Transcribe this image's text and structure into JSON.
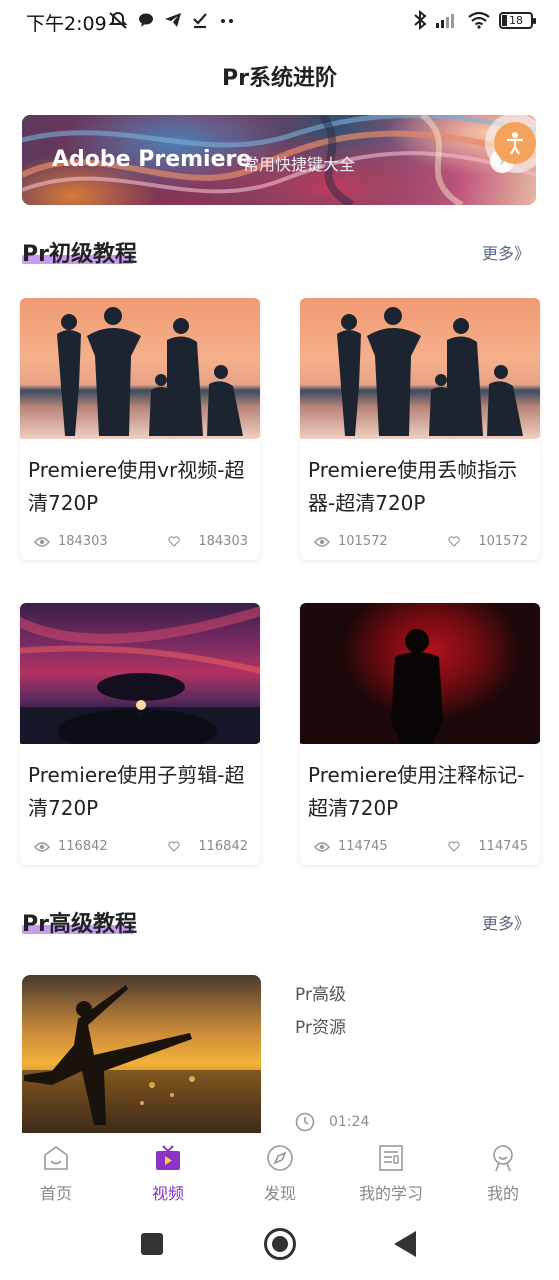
{
  "status_bar": {
    "time": "下午2:09",
    "battery": "18"
  },
  "header": {
    "title": "Pr系统进阶"
  },
  "banner": {
    "title": "Adobe Premiere",
    "subtitle": "常用快捷键大全"
  },
  "sections": {
    "basic": {
      "title": "Pr初级教程",
      "more": "更多》"
    },
    "advanced": {
      "title": "Pr高级教程",
      "more": "更多》"
    }
  },
  "cards": [
    {
      "title": "Premiere使用vr视频-超清720P",
      "views": "184303",
      "likes": "184303"
    },
    {
      "title": "Premiere使用丢帧指示器-超清720P",
      "views": "101572",
      "likes": "101572"
    },
    {
      "title": "Premiere使用子剪辑-超清720P",
      "views": "116842",
      "likes": "116842"
    },
    {
      "title": "Premiere使用注释标记-超清720P",
      "views": "114745",
      "likes": "114745"
    }
  ],
  "advanced_item": {
    "line1": "Pr高级",
    "line2": "Pr资源",
    "duration": "01:24"
  },
  "tabs": [
    {
      "label": "首页",
      "icon": "home-icon"
    },
    {
      "label": "视频",
      "icon": "tv-icon"
    },
    {
      "label": "发现",
      "icon": "compass-icon"
    },
    {
      "label": "我的学习",
      "icon": "notebook-icon"
    },
    {
      "label": "我的",
      "icon": "user-icon"
    }
  ],
  "colors": {
    "accent": "#8b33c9",
    "underline": "#c99cf2",
    "more_link": "#5c6785"
  }
}
